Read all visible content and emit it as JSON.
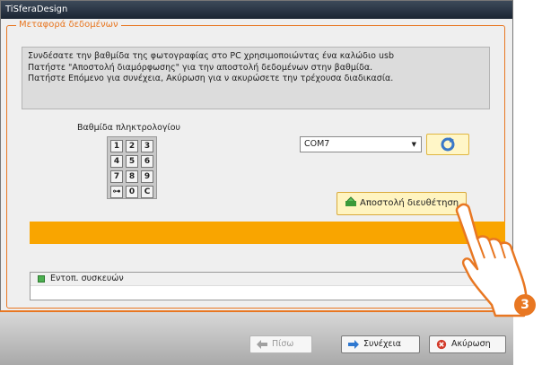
{
  "window": {
    "title": "TiSferaDesign"
  },
  "group": {
    "title": "Μεταφορά δεδομένων"
  },
  "instructions": [
    "Συνδέσατε την βαθμίδα της φωτογραφίας στο PC χρησιμοποιώντας ένα καλώδιο usb",
    "Πατήστε \"Αποστολή διαμόρφωσης\" για την αποστολή δεδομένων στην βαθμίδα.",
    "Πατήστε Επόμενο για συνέχεια, Ακύρωση για ν ακυρώσετε την τρέχουσα διαδικασία."
  ],
  "keypad": {
    "label": "Βαθμίδα πληκτρολογίου",
    "keys": [
      "1",
      "2",
      "3",
      "4",
      "5",
      "6",
      "7",
      "8",
      "9",
      "⊶",
      "0",
      "C"
    ]
  },
  "port": {
    "selected": "COM7"
  },
  "send_button": {
    "label": "Αποστολή διευθέτηση"
  },
  "device_list": {
    "item": "Εντοπ. συσκευών"
  },
  "footer": {
    "back": "Πίσω",
    "next": "Συνέχεια",
    "cancel": "Ακύρωση"
  },
  "callout": {
    "number": "3"
  },
  "colors": {
    "accent": "#e87722",
    "progress": "#f9a500",
    "title_bar": "#1b2533"
  },
  "icons": [
    "refresh-icon",
    "send-icon",
    "back-arrow-icon",
    "next-arrow-icon",
    "cancel-icon",
    "pointing-hand-icon"
  ]
}
